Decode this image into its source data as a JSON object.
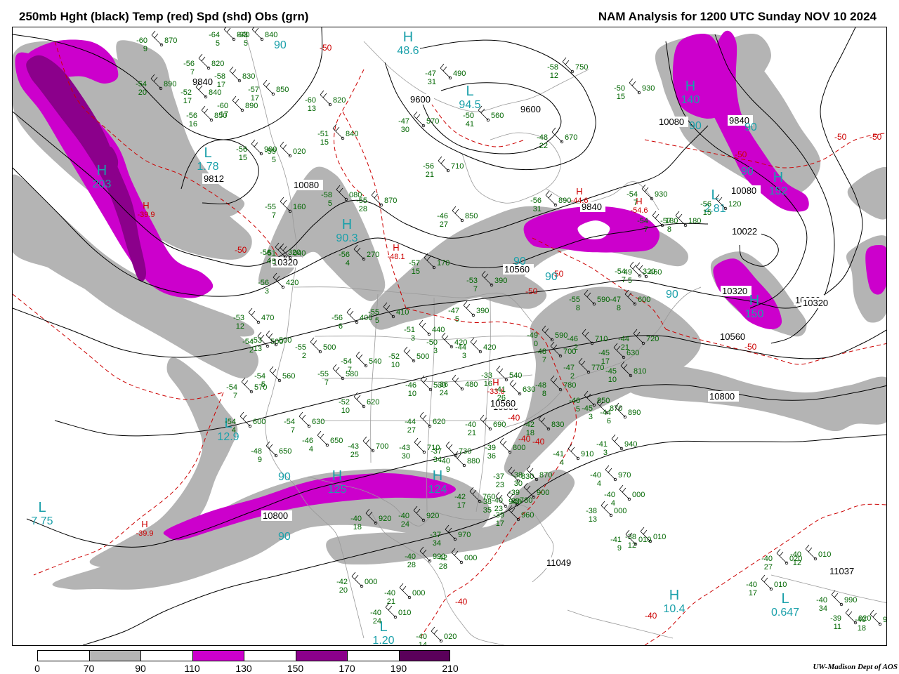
{
  "header": {
    "left_title": "250mb Hght (black) Temp (red) Spd (shd) Obs (grn)",
    "right_title": "NAM Analysis for 1200 UTC Sunday  NOV 10 2024"
  },
  "legend": {
    "ticks": [
      "0",
      "70",
      "90",
      "110",
      "130",
      "150",
      "170",
      "190",
      "210"
    ],
    "colors": [
      "#ffffff",
      "#b4b4b4",
      "#ffffff",
      "#cc00cc",
      "#ffffff",
      "#8b008b",
      "#ffffff",
      "#5a005a"
    ]
  },
  "credit": "UW-Madison  Dept of AOS",
  "colors": {
    "height": "#000000",
    "temp": "#cc0000",
    "speed_70": "#b4b4b4",
    "speed_110": "#cc00cc",
    "speed_150": "#8b008b",
    "speed_190": "#5a005a",
    "obs": "#006600",
    "center": "#1aa0aa",
    "geo": "#999999"
  },
  "height_labels": [
    "9840",
    "9812",
    "9600",
    "9600",
    "9840",
    "10080",
    "10080",
    "10022",
    "10320",
    "10320",
    "10320",
    "10560",
    "10560",
    "10800",
    "10800",
    "10080",
    "10560",
    "9840",
    "10800",
    "11049",
    "11037",
    "10320"
  ],
  "temp_labels": [
    "-50",
    "-50",
    "-50",
    "-50",
    "-50",
    "-40",
    "-40",
    "-40",
    "-40",
    "-40",
    "-50",
    "-50",
    "-50"
  ],
  "centers": [
    {
      "letter": "H",
      "value": "48.6"
    },
    {
      "letter": "L",
      "value": "94.5"
    },
    {
      "letter": "L",
      "value": "1.78"
    },
    {
      "letter": "H",
      "value": "203"
    },
    {
      "letter": "H",
      "value": "90.3"
    },
    {
      "letter": "H",
      "value": "140"
    },
    {
      "letter": "H",
      "value": "152"
    },
    {
      "letter": "L",
      "value": "2.81"
    },
    {
      "letter": "H",
      "value": "150"
    },
    {
      "letter": "L",
      "value": "12.9"
    },
    {
      "letter": "L",
      "value": "7.75"
    },
    {
      "letter": "H",
      "value": "125"
    },
    {
      "letter": "H",
      "value": "124"
    },
    {
      "letter": "H",
      "value": "10.4"
    },
    {
      "letter": "L",
      "value": "0.647"
    },
    {
      "letter": "L",
      "value": "1.20"
    },
    {
      "letter": "H",
      "value": "-39.9"
    },
    {
      "letter": "H",
      "value": "-48.1"
    },
    {
      "letter": "H",
      "value": "-44.6"
    },
    {
      "letter": "H",
      "value": "-54.6"
    },
    {
      "letter": "H",
      "value": "-33.6"
    },
    {
      "letter": "H",
      "value": "-39.9"
    }
  ],
  "cyan_labels": [
    "90",
    "90",
    "90",
    "90",
    "90",
    "90",
    "90",
    "90",
    "90"
  ],
  "obs": [
    {
      "t": "-60",
      "h": "870",
      "d": "9"
    },
    {
      "t": "-64",
      "h": "840",
      "d": "5"
    },
    {
      "t": "-63",
      "h": "840",
      "d": "5"
    },
    {
      "t": "-56",
      "h": "820",
      "d": "7"
    },
    {
      "t": "-54",
      "h": "890",
      "d": "20"
    },
    {
      "t": "-58",
      "h": "830",
      "d": "17"
    },
    {
      "t": "-52",
      "h": "840",
      "d": "17"
    },
    {
      "t": "-57",
      "h": "850",
      "d": "17"
    },
    {
      "t": "-60",
      "h": "890",
      "d": "17"
    },
    {
      "t": "-56",
      "h": "850",
      "d": "16"
    },
    {
      "t": "-60",
      "h": "820",
      "d": "13"
    },
    {
      "t": "-47",
      "h": "490",
      "d": "31"
    },
    {
      "t": "-47",
      "h": "570",
      "d": "30"
    },
    {
      "t": "-50",
      "h": "560",
      "d": "41"
    },
    {
      "t": "-58",
      "h": "750",
      "d": "12"
    },
    {
      "t": "-50",
      "h": "930",
      "d": "15"
    },
    {
      "t": "-48",
      "h": "670",
      "d": "22"
    },
    {
      "t": "-51",
      "h": "840",
      "d": "15"
    },
    {
      "t": "-56",
      "h": "990",
      "d": "15"
    },
    {
      "t": "-59",
      "h": "020",
      "d": "5"
    },
    {
      "t": "-56",
      "h": "710",
      "d": "21"
    },
    {
      "t": "-55",
      "h": "160",
      "d": "7"
    },
    {
      "t": "-58",
      "h": "080",
      "d": "5"
    },
    {
      "t": "-55",
      "h": "870",
      "d": "28"
    },
    {
      "t": "-56",
      "h": "890",
      "d": "31"
    },
    {
      "t": "-46",
      "h": "850",
      "d": "27"
    },
    {
      "t": "-54",
      "h": "930",
      "d": "7"
    },
    {
      "t": "-56",
      "h": "120",
      "d": "15"
    },
    {
      "t": "-51",
      "h": "040",
      "d": "5"
    },
    {
      "t": "-56",
      "h": "270",
      "d": "4"
    },
    {
      "t": "-57",
      "h": "180",
      "d": "8"
    },
    {
      "t": "-57",
      "h": "170",
      "d": "15"
    },
    {
      "t": "-54",
      "h": "180",
      "d": "7"
    },
    {
      "t": "-56",
      "h": "320",
      "d": "4"
    },
    {
      "t": "-54",
      "h": "320",
      "d": "7"
    },
    {
      "t": "-56",
      "h": "420",
      "d": "3"
    },
    {
      "t": "-53",
      "h": "390",
      "d": "7"
    },
    {
      "t": "-49",
      "h": "460",
      "d": "5"
    },
    {
      "t": "-53",
      "h": "470",
      "d": "12"
    },
    {
      "t": "-56",
      "h": "400",
      "d": "6"
    },
    {
      "t": "-55",
      "h": "410",
      "d": "5"
    },
    {
      "t": "-47",
      "h": "390",
      "d": "5"
    },
    {
      "t": "-54",
      "h": "500",
      "d": "2"
    },
    {
      "t": "-55",
      "h": "590",
      "d": "8"
    },
    {
      "t": "-47",
      "h": "600",
      "d": "8"
    },
    {
      "t": "-53",
      "h": "500",
      "d": "13"
    },
    {
      "t": "-55",
      "h": "500",
      "d": "2"
    },
    {
      "t": "-51",
      "h": "440",
      "d": "3"
    },
    {
      "t": "-50",
      "h": "420",
      "d": "3"
    },
    {
      "t": "-44",
      "h": "420",
      "d": "3"
    },
    {
      "t": "-49",
      "h": "590",
      "d": "0"
    },
    {
      "t": "-46",
      "h": "710",
      "d": "2"
    },
    {
      "t": "-44",
      "h": "720",
      "d": "21"
    },
    {
      "t": "-45",
      "h": "630",
      "d": "17"
    },
    {
      "t": "-54",
      "h": "540",
      "d": "7"
    },
    {
      "t": "-52",
      "h": "500",
      "d": "10"
    },
    {
      "t": "-48",
      "h": "700",
      "d": "7"
    },
    {
      "t": "-47",
      "h": "770",
      "d": "2"
    },
    {
      "t": "-45",
      "h": "810",
      "d": "10"
    },
    {
      "t": "-54",
      "h": "560",
      "d": "5"
    },
    {
      "t": "-55",
      "h": "580",
      "d": "7"
    },
    {
      "t": "-54",
      "h": "570",
      "d": "7"
    },
    {
      "t": "-46",
      "h": "530",
      "d": "10"
    },
    {
      "t": "-36",
      "h": "480",
      "d": "24"
    },
    {
      "t": "-33",
      "h": "540",
      "d": "16"
    },
    {
      "t": "-41",
      "h": "630",
      "d": "26"
    },
    {
      "t": "-48",
      "h": "780",
      "d": "8"
    },
    {
      "t": "-46",
      "h": "850",
      "d": "5"
    },
    {
      "t": "-45",
      "h": "870",
      "d": "3"
    },
    {
      "t": "-44",
      "h": "890",
      "d": "6"
    },
    {
      "t": "-52",
      "h": "620",
      "d": "10"
    },
    {
      "t": "-54",
      "h": "600",
      "d": "4"
    },
    {
      "t": "-54",
      "h": "630",
      "d": "7"
    },
    {
      "t": "-48",
      "h": "650",
      "d": "9"
    },
    {
      "t": "-46",
      "h": "650",
      "d": "4"
    },
    {
      "t": "-44",
      "h": "620",
      "d": "27"
    },
    {
      "t": "-40",
      "h": "690",
      "d": "21"
    },
    {
      "t": "-42",
      "h": "830",
      "d": "18"
    },
    {
      "t": "-41",
      "h": "940",
      "d": "3"
    },
    {
      "t": "-41",
      "h": "910",
      "d": "4"
    },
    {
      "t": "-43",
      "h": "700",
      "d": "25"
    },
    {
      "t": "-43",
      "h": "710",
      "d": "30"
    },
    {
      "t": "-37",
      "h": "730",
      "d": "34"
    },
    {
      "t": "-39",
      "h": "800",
      "d": "36"
    },
    {
      "t": "-40",
      "h": "880",
      "d": "9"
    },
    {
      "t": "-37",
      "h": "830",
      "d": "23"
    },
    {
      "t": "-38",
      "h": "870",
      "d": "30"
    },
    {
      "t": "-39",
      "h": "900",
      "d": "29"
    },
    {
      "t": "-40",
      "h": "970",
      "d": "4"
    },
    {
      "t": "-42",
      "h": "760",
      "d": "17"
    },
    {
      "t": "-40",
      "h": "780",
      "d": "23"
    },
    {
      "t": "-38",
      "h": "940",
      "d": "35"
    },
    {
      "t": "-39",
      "h": "960",
      "d": "17"
    },
    {
      "t": "-40",
      "h": "000",
      "d": "4"
    },
    {
      "t": "-38",
      "h": "000",
      "d": "13"
    },
    {
      "t": "-38",
      "h": "010",
      "d": "12"
    },
    {
      "t": "-41",
      "h": "010",
      "d": "9"
    },
    {
      "t": "-40",
      "h": "920",
      "d": "18"
    },
    {
      "t": "-40",
      "h": "920",
      "d": "24"
    },
    {
      "t": "-37",
      "h": "970",
      "d": "34"
    },
    {
      "t": "-40",
      "h": "990",
      "d": "28"
    },
    {
      "t": "-42",
      "h": "000",
      "d": "28"
    },
    {
      "t": "-42",
      "h": "000",
      "d": "20"
    },
    {
      "t": "-40",
      "h": "000",
      "d": "21"
    },
    {
      "t": "-40",
      "h": "010",
      "d": "24"
    },
    {
      "t": "-40",
      "h": "020",
      "d": "14"
    },
    {
      "t": "-40",
      "h": "020",
      "d": "27"
    },
    {
      "t": "-40",
      "h": "010",
      "d": "12"
    },
    {
      "t": "-40",
      "h": "010",
      "d": "17"
    },
    {
      "t": "-40",
      "h": "980",
      "d": "18"
    },
    {
      "t": "-40",
      "h": "990",
      "d": "34"
    },
    {
      "t": "-39",
      "h": "020",
      "d": "11"
    },
    {
      "t": "-39",
      "h": "010",
      "d": "10"
    }
  ]
}
